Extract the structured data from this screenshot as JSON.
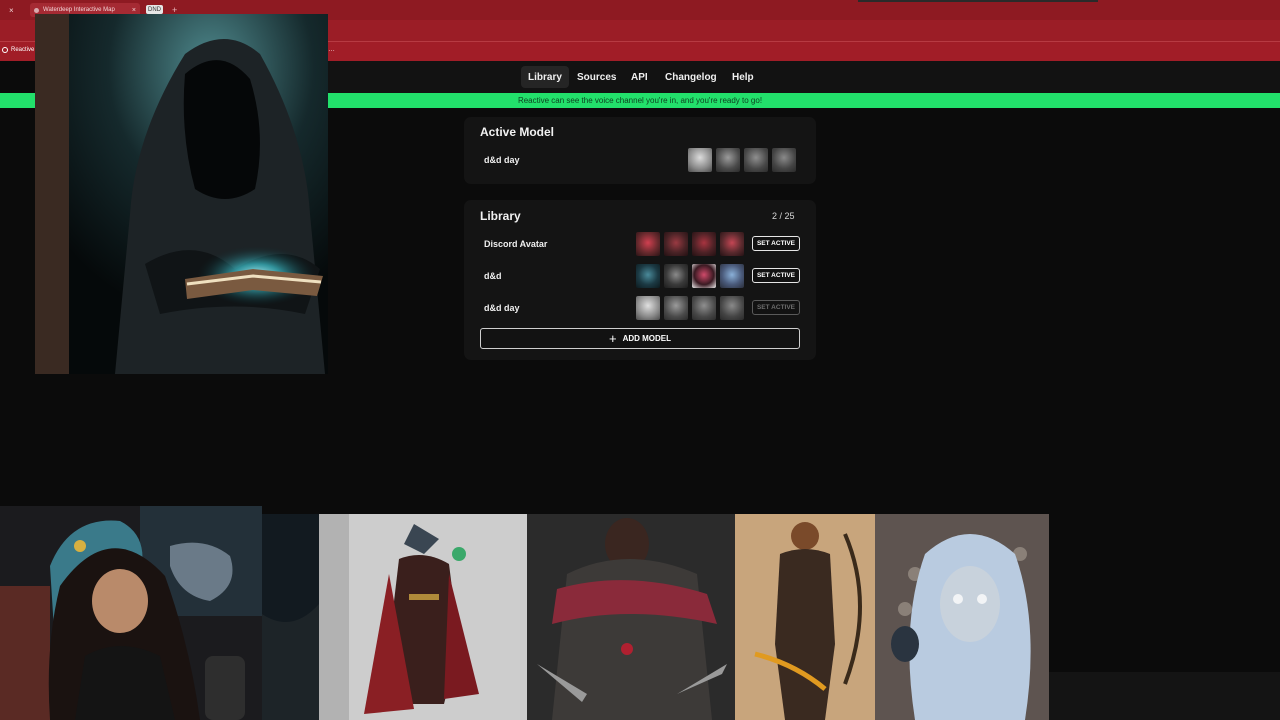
{
  "browser": {
    "tabs": [
      {
        "label": "Waterdeep Interactive Map"
      },
      {
        "label": "DND"
      }
    ],
    "new_tab_symbol": "+",
    "close_symbol": "×",
    "bookmarks": {
      "first": "Reactive",
      "overflow": "…"
    }
  },
  "nav": {
    "items": [
      {
        "label": "Library",
        "active": true
      },
      {
        "label": "Sources"
      },
      {
        "label": "API"
      },
      {
        "label": "Changelog"
      },
      {
        "label": "Help"
      }
    ]
  },
  "status": {
    "text": "Reactive can see the voice channel you're in, and you're ready to go!",
    "color": "#22e06b"
  },
  "active_model": {
    "title": "Active Model",
    "name": "d&d day"
  },
  "library": {
    "title": "Library",
    "count": "2 / 25",
    "models": [
      {
        "name": "Discord Avatar",
        "button": "SET ACTIVE",
        "button_enabled": true
      },
      {
        "name": "d&d",
        "button": "SET ACTIVE",
        "button_enabled": true
      },
      {
        "name": "d&d day",
        "button": "SET ACTIVE",
        "button_enabled": false
      }
    ],
    "add_label": "ADD MODEL"
  },
  "colors": {
    "brand": "#9b1d26",
    "status_green": "#22e06b",
    "panel": "#141414"
  },
  "icons": [
    "close-icon",
    "plus-icon",
    "favicon-icon",
    "reactive-icon"
  ]
}
